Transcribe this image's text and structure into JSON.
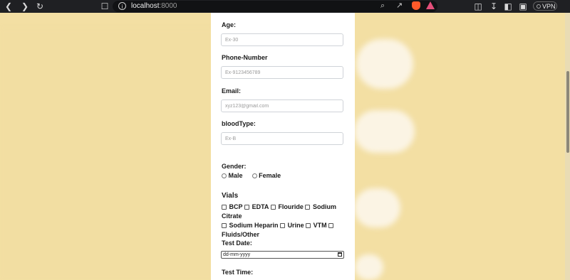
{
  "browser": {
    "url_host": "localhost",
    "url_port": ":8000",
    "vpn_label": "VPN"
  },
  "form": {
    "age": {
      "label": "Age:",
      "placeholder": "Ex-30"
    },
    "phone": {
      "label": "Phone-Number",
      "placeholder": "Ex-9123456789"
    },
    "email": {
      "label": "Email:",
      "placeholder": "xyz123@gmail.com"
    },
    "blood": {
      "label": "bloodType:",
      "placeholder": "Ex-B"
    },
    "gender": {
      "label": "Gender:",
      "options": [
        "Male",
        "Female"
      ]
    },
    "vials": {
      "title": "Vials",
      "options": [
        "BCP",
        "EDTA",
        "Flouride",
        "Sodium Citrate",
        "Sodium Heparin",
        "Urine",
        "VTM",
        "Fluids/Other"
      ]
    },
    "test_date": {
      "label": "Test Date:",
      "value": "dd-mm-yyyy"
    },
    "test_time": {
      "label": "Test Time:"
    }
  },
  "colors": {
    "page_bg": "#f3dfa3",
    "card_bg": "#ffffff",
    "toolbar_bg": "#1f2023"
  }
}
